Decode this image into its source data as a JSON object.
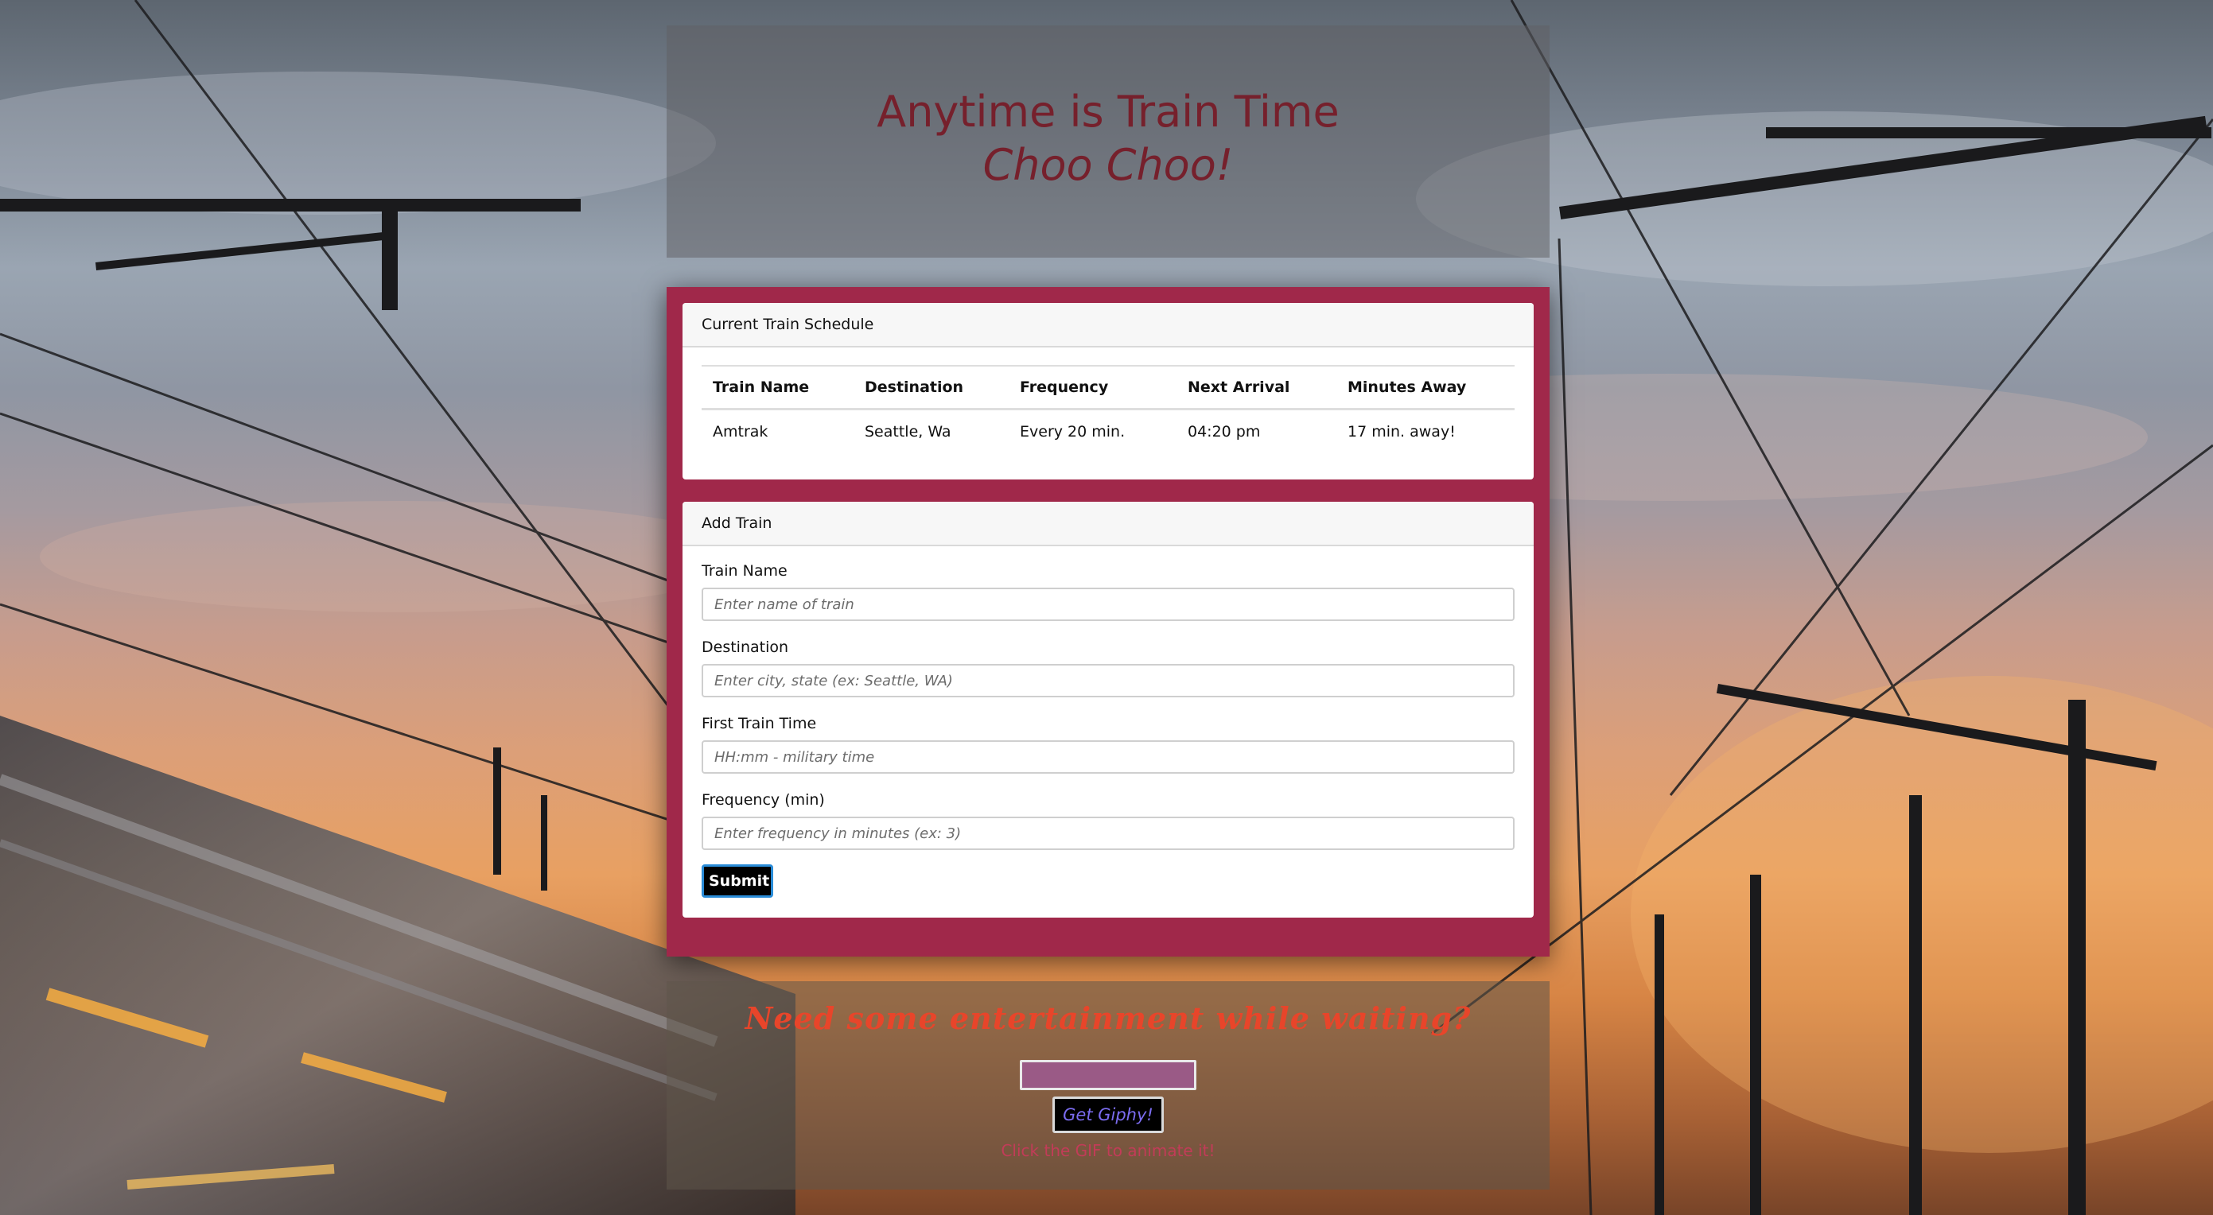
{
  "header": {
    "title": "Anytime is Train Time",
    "subtitle": "Choo Choo!"
  },
  "schedule": {
    "header": "Current Train Schedule",
    "columns": [
      "Train Name",
      "Destination",
      "Frequency",
      "Next Arrival",
      "Minutes Away"
    ],
    "rows": [
      [
        "Amtrak",
        "Seattle, Wa",
        "Every 20 min.",
        "04:20 pm",
        "17 min. away!"
      ]
    ]
  },
  "add_train": {
    "header": "Add Train",
    "fields": [
      {
        "label": "Train Name",
        "placeholder": "Enter name of train",
        "value": ""
      },
      {
        "label": "Destination",
        "placeholder": "Enter city, state (ex: Seattle, WA)",
        "value": ""
      },
      {
        "label": "First Train Time",
        "placeholder": "HH:mm - military time",
        "value": ""
      },
      {
        "label": "Frequency (min)",
        "placeholder": "Enter frequency in minutes (ex: 3)",
        "value": ""
      }
    ],
    "submit_label": "Submit"
  },
  "giphy": {
    "heading": "Need some entertainment while waiting?",
    "input_value": "",
    "button_label": "Get Giphy!",
    "hint": "Click the GIF to animate it!"
  },
  "colors": {
    "accent": "#a0284a",
    "title": "#76202c",
    "giphy_heading": "#e8452a"
  }
}
